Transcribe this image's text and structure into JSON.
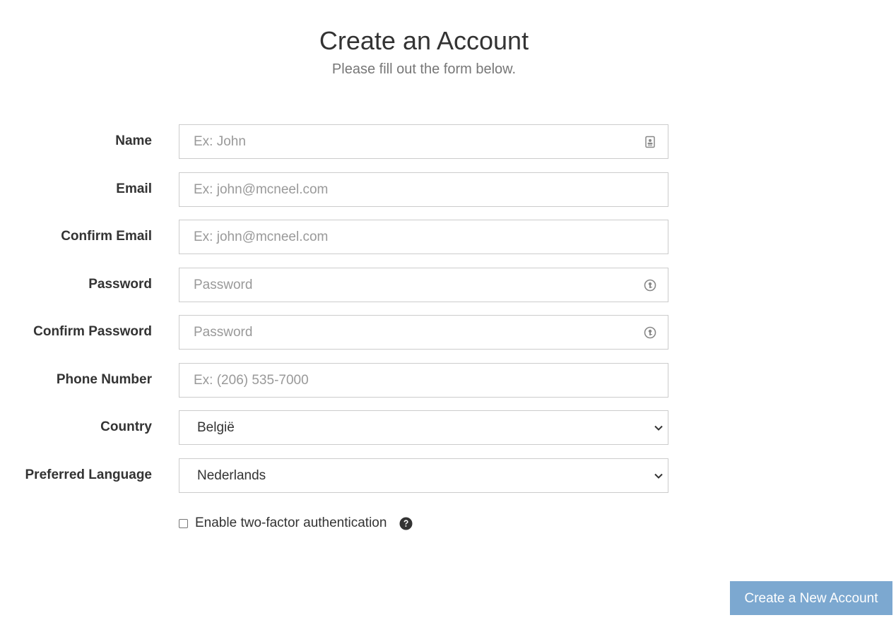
{
  "header": {
    "title": "Create an Account",
    "subtitle": "Please fill out the form below."
  },
  "form": {
    "name": {
      "label": "Name",
      "placeholder": "Ex: John",
      "value": "",
      "icon": "contact-card-icon"
    },
    "email": {
      "label": "Email",
      "placeholder": "Ex: john@mcneel.com",
      "value": ""
    },
    "confirm_email": {
      "label": "Confirm Email",
      "placeholder": "Ex: john@mcneel.com",
      "value": ""
    },
    "password": {
      "label": "Password",
      "placeholder": "Password",
      "value": "",
      "icon": "password-manager-icon"
    },
    "confirm_password": {
      "label": "Confirm Password",
      "placeholder": "Password",
      "value": "",
      "icon": "password-manager-icon"
    },
    "phone": {
      "label": "Phone Number",
      "placeholder": "Ex: (206) 535-7000",
      "value": ""
    },
    "country": {
      "label": "Country",
      "selected": "België"
    },
    "language": {
      "label": "Preferred Language",
      "selected": "Nederlands"
    },
    "two_factor": {
      "label": "Enable two-factor authentication",
      "checked": false,
      "help_icon": "question-circle-icon"
    }
  },
  "submit_label": "Create a New Account",
  "colors": {
    "submit_bg": "#7ca8d0",
    "border": "#cccccc",
    "text": "#333333",
    "placeholder": "#999999"
  }
}
